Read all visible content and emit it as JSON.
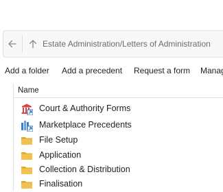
{
  "address": {
    "path": "Estate Administration/Letters of Administration"
  },
  "toolbar": {
    "add_folder": "Add a folder",
    "add_precedent": "Add a precedent",
    "request_form": "Request a form",
    "manage_truncated": "Manag"
  },
  "list": {
    "column_name": "Name",
    "items": [
      {
        "label": "Court & Authority Forms",
        "icon": "court-forms-icon"
      },
      {
        "label": "Marketplace Precedents",
        "icon": "marketplace-icon"
      },
      {
        "label": "File Setup",
        "icon": "folder-icon"
      },
      {
        "label": "Application",
        "icon": "folder-icon"
      },
      {
        "label": "Collection & Distribution",
        "icon": "folder-icon"
      },
      {
        "label": "Finalisation",
        "icon": "folder-icon"
      }
    ]
  },
  "colors": {
    "folder": "#f2c14e",
    "folder_dark": "#e0a82e",
    "court_red": "#d64545",
    "shortcut_blue": "#2b6cb0",
    "market_blue": "#3a7bd5"
  }
}
